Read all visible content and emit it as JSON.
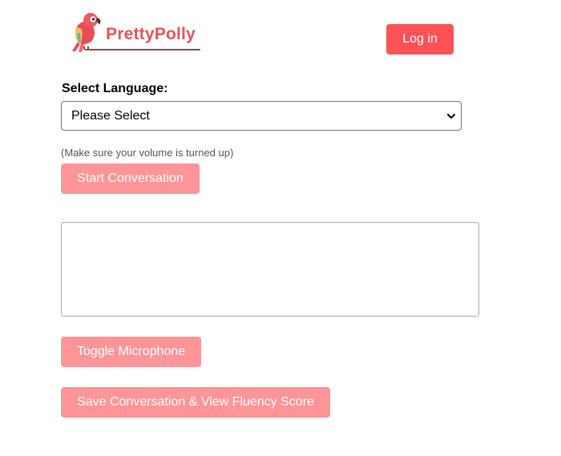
{
  "brand": {
    "name": "PrettyPolly",
    "logo_icon": "parrot-icon",
    "color": "#e5545a"
  },
  "header": {
    "login_label": "Log in",
    "login_color": "#ff5257"
  },
  "language": {
    "label": "Select Language:",
    "selected": "Please Select"
  },
  "hint": "(Make sure your volume is turned up)",
  "buttons": {
    "start": "Start Conversation",
    "toggle_mic": "Toggle Microphone",
    "save": "Save Conversation & View Fluency Score",
    "color": "#ff9598"
  },
  "transcript": {
    "text": ""
  }
}
